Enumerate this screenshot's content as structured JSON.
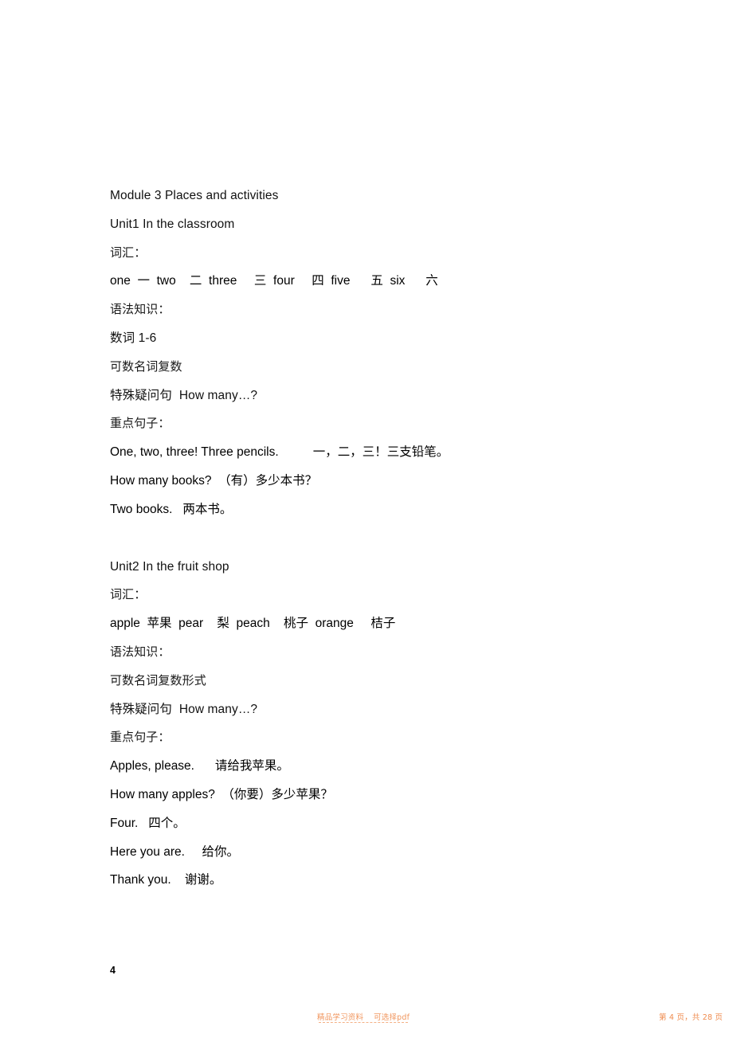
{
  "document": {
    "module_title": "Module 3 Places and activities",
    "units": [
      {
        "heading": "Unit1 In the classroom",
        "vocab_label": "词汇：",
        "vocab_line": "one  一  two    二  three     三  four     四  five      五  six      六",
        "grammar_label": "语法知识：",
        "grammar_points": [
          "数词 1-6",
          "可数名词复数",
          "特殊疑问句  How many…?"
        ],
        "sentences_label": "重点句子：",
        "sentences": [
          "One, two, three! Three pencils.          一，二，三！三支铅笔。",
          "How many books?  （有）多少本书？",
          "Two books.   两本书。"
        ]
      },
      {
        "heading": "Unit2 In the fruit shop",
        "vocab_label": "词汇：",
        "vocab_line": "apple  苹果  pear    梨  peach    桃子  orange     桔子",
        "grammar_label": "语法知识：",
        "grammar_points": [
          "可数名词复数形式",
          "特殊疑问句  How many…?"
        ],
        "sentences_label": "重点句子：",
        "sentences": [
          "Apples, please.      请给我苹果。",
          "How many apples?  （你要）多少苹果？",
          "Four.   四个。",
          "Here you are.     给你。",
          "Thank you.    谢谢。"
        ]
      }
    ]
  },
  "page_number": "4",
  "footer": {
    "watermark": "精品学习资料    可选择pdf",
    "page_count": "第 4 页，共 28 页"
  },
  "colors": {
    "text": "#111111",
    "watermark": "#f09055",
    "page_background": "#ffffff"
  }
}
